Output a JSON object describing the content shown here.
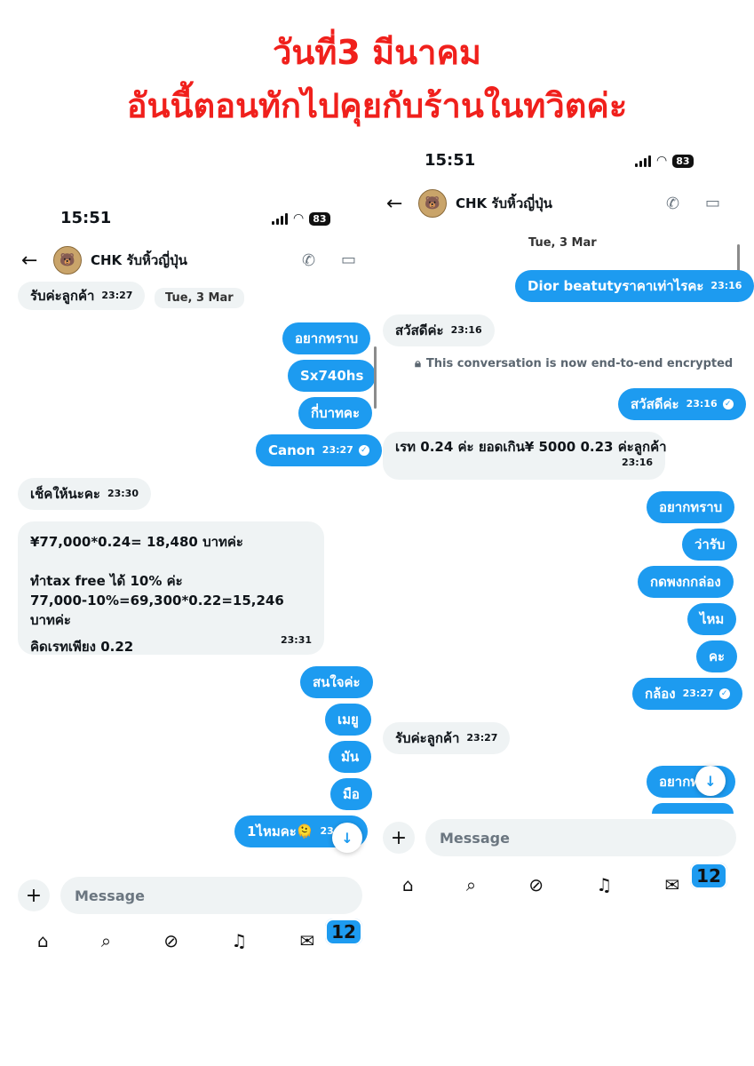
{
  "headline": {
    "line1": "วันที่3 มีนาคม",
    "line2": "อันนี้ตอนทักไปคุยกับร้านในทวิตค่ะ"
  },
  "left_screen": {
    "time": "15:51",
    "battery": "83",
    "contact_name": "CHK รับหิ้วญี่ปุ่น",
    "date_label": "Tue, 3 Mar",
    "messages": [
      {
        "text": "รับค่ะลูกค้า",
        "time": "23:27",
        "from": "them"
      },
      {
        "text": "อยากทราบ",
        "time": "",
        "from": "me"
      },
      {
        "text": "Sx740hs",
        "time": "",
        "from": "me"
      },
      {
        "text": "กี่บาทคะ",
        "time": "",
        "from": "me"
      },
      {
        "text": "Canon",
        "time": "23:27",
        "from": "me"
      },
      {
        "text": "เช็คให้นะคะ",
        "time": "23:30",
        "from": "them"
      },
      {
        "text": "สนใจค่ะ",
        "time": "",
        "from": "me"
      },
      {
        "text": "เมยู",
        "time": "",
        "from": "me"
      },
      {
        "text": "มัน",
        "time": "",
        "from": "me"
      },
      {
        "text": "มือ",
        "time": "",
        "from": "me"
      },
      {
        "text": "1ไหมคะ🫠",
        "time": "23:",
        "from": "me"
      }
    ],
    "long_message": {
      "line1": "¥77,000*0.24= 18,480 บาทค่ะ",
      "line2": "ทำtax free ได้ 10% ค่ะ",
      "line3": "77,000-10%=69,300*0.22=15,246 บาทค่ะ",
      "line4": "คิดเรทเพียง 0.22",
      "time": "23:31"
    },
    "composer_placeholder": "Message",
    "dm_badge": "12"
  },
  "right_screen": {
    "time": "15:51",
    "battery": "83",
    "contact_name": "CHK รับหิ้วญี่ปุ่น",
    "date_label": "Tue, 3 Mar",
    "encryption_notice": "This conversation is now end-to-end encrypted",
    "messages": [
      {
        "text": "Dior beatutyราคาเท่าไรคะ",
        "time": "23:16",
        "from": "me"
      },
      {
        "text": "สวัสดีค่ะ",
        "time": "23:16",
        "from": "them"
      },
      {
        "text": "สวัสดีค่ะ",
        "time": "23:16",
        "from": "me"
      },
      {
        "text": "อยากทราบ",
        "time": "",
        "from": "me"
      },
      {
        "text": "ว่ารับ",
        "time": "",
        "from": "me"
      },
      {
        "text": "กดพงกกล่อง",
        "time": "",
        "from": "me"
      },
      {
        "text": "ไหม",
        "time": "",
        "from": "me"
      },
      {
        "text": "คะ",
        "time": "",
        "from": "me"
      },
      {
        "text": "กล้อง",
        "time": "23:27",
        "from": "me"
      },
      {
        "text": "รับค่ะลูกค้า",
        "time": "23:27",
        "from": "them"
      },
      {
        "text": "อยากท",
        "time": "",
        "from": "me"
      }
    ],
    "rate_message": {
      "text": "เรท 0.24 ค่ะ ยอดเกิน¥ 5000 0.23 ค่ะลูกค้า",
      "time": "23:16"
    },
    "composer_placeholder": "Message",
    "dm_badge": "12"
  },
  "colors": {
    "headline": "#f0201c",
    "accent": "#1d9bf0",
    "incoming_bubble": "#eff3f4"
  },
  "icons": [
    "back-arrow-icon",
    "phone-icon",
    "video-icon",
    "lock-icon",
    "plus-icon",
    "home-icon",
    "search-icon",
    "grok-icon",
    "bell-icon",
    "mail-icon",
    "arrow-down-icon"
  ]
}
